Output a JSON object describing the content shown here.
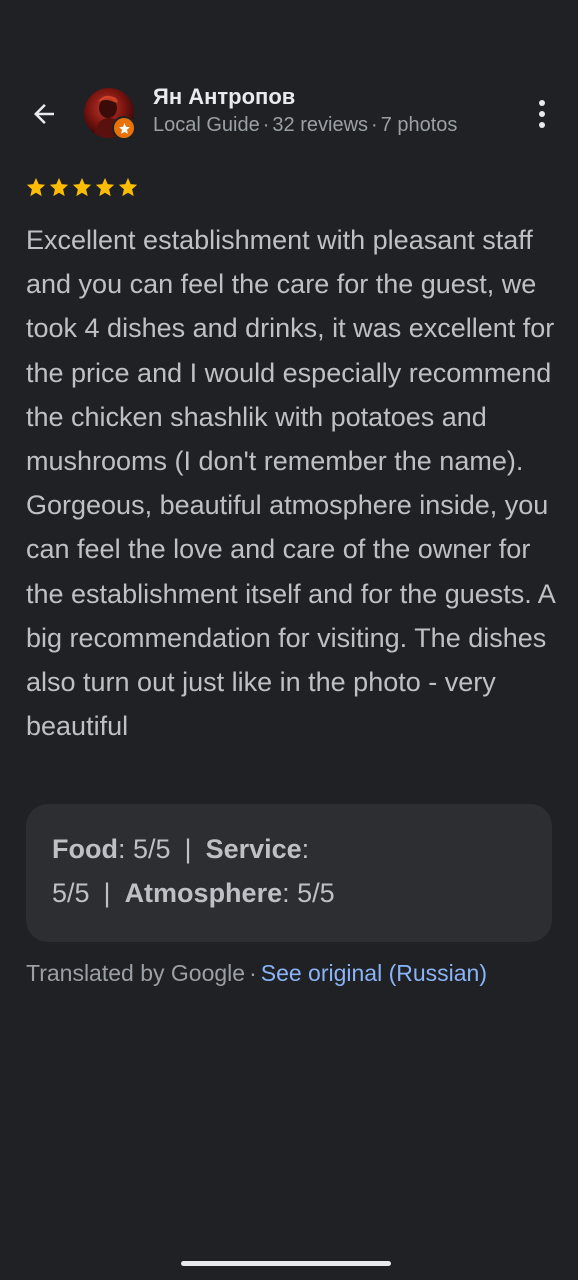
{
  "reviewer": {
    "name": "Ян Антропов",
    "level": "Local Guide",
    "reviews": "32 reviews",
    "photos": "7 photos"
  },
  "rating": {
    "stars": 5,
    "star_color": "#fbbc04"
  },
  "review": {
    "text": "Excellent establishment with pleasant staff and you can feel the care for the guest, we took 4 dishes and drinks, it was excellent for the price and I would especially recommend the chicken shashlik with potatoes and mushrooms (I don't remember the name). Gorgeous, beautiful atmosphere inside, you can feel the love and care of the owner for the establishment itself and for the guests. A big recommendation for visiting. The dishes also turn out just like in the photo - very beautiful"
  },
  "ratings_card": {
    "food_label": "Food",
    "food_value": "5/5",
    "service_label": "Service",
    "service_value": "5/5",
    "atmosphere_label": "Atmosphere",
    "atmosphere_value": "5/5",
    "separator": "|"
  },
  "translation": {
    "note": "Translated by Google",
    "link": "See original (Russian)",
    "link_color": "#8ab4f8"
  },
  "icons": {
    "back": "arrow-back-icon",
    "more": "more-vert-icon",
    "badge": "local-guide-star-icon"
  },
  "colors": {
    "background": "#202124",
    "card": "#2d2e31",
    "badge": "#e8710a"
  }
}
